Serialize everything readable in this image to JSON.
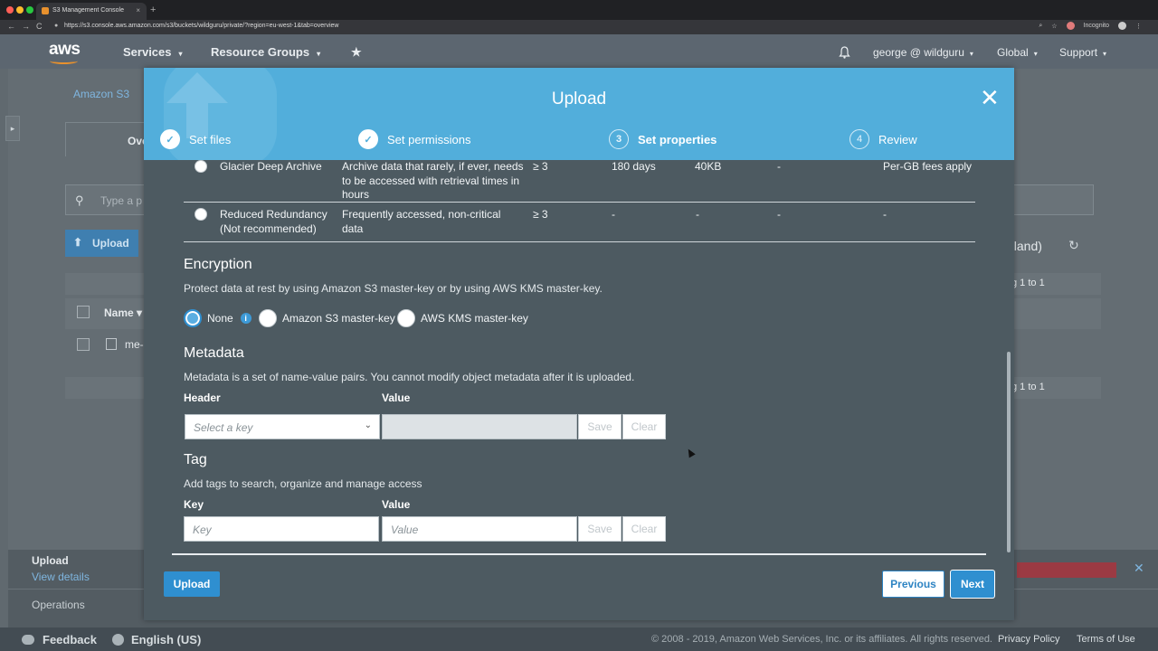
{
  "browser": {
    "tab_title": "S3 Management Console",
    "tab_close": "×",
    "new_tab": "+",
    "url": "https://s3.console.aws.amazon.com/s3/buckets/wildguru/private/?region=eu-west-1&tab=overview",
    "incognito": "Incognito",
    "back": "←",
    "forward": "→",
    "reload": "C"
  },
  "aws_nav": {
    "logo": "aws",
    "services": "Services",
    "resource_groups": "Resource Groups",
    "pin": "★",
    "user": "george @ wildguru",
    "region": "Global",
    "support": "Support",
    "caret": "▾",
    "bell": "🔔"
  },
  "background": {
    "breadcrumb": "Amazon S3",
    "tab_overview": "Ove",
    "search_placeholder": "Type a p",
    "upload_button": "Upload",
    "region_fragment": "eland)",
    "pagination_1": "g 1 to 1",
    "pagination_2": "g 1 to 1",
    "name_header": "Name",
    "file_name": "me-",
    "side_toggle": "▸"
  },
  "ops_bar": {
    "upload_title": "Upload",
    "view_details": "View details",
    "operations": "Operations",
    "close": "✕"
  },
  "footer": {
    "feedback": "Feedback",
    "language": "English (US)",
    "copyright": "© 2008 - 2019, Amazon Web Services, Inc. or its affiliates. All rights reserved.",
    "privacy": "Privacy Policy",
    "terms": "Terms of Use"
  },
  "modal": {
    "title": "Upload",
    "close": "✕",
    "steps": [
      {
        "label": "Set files",
        "marker": "✓"
      },
      {
        "label": "Set permissions",
        "marker": "✓"
      },
      {
        "label": "Set properties",
        "marker": "3"
      },
      {
        "label": "Review",
        "marker": "4"
      }
    ],
    "storage_classes": [
      {
        "name": "Glacier Deep Archive",
        "description": "Archive data that rarely, if ever, needs to be accessed with retrieval times in hours",
        "az": "≥ 3",
        "min_duration": "180 days",
        "min_size": "40KB",
        "monitoring": "-",
        "retrieval": "Per-GB fees apply"
      },
      {
        "name": "Reduced Redundancy (Not recommended)",
        "description": "Frequently accessed, non-critical data",
        "az": "≥ 3",
        "min_duration": "-",
        "min_size": "-",
        "monitoring": "-",
        "retrieval": "-"
      }
    ],
    "encryption": {
      "title": "Encryption",
      "description": "Protect data at rest by using Amazon S3 master-key or by using AWS KMS master-key.",
      "options": [
        "None",
        "Amazon S3 master-key",
        "AWS KMS master-key"
      ],
      "selected": "None",
      "info": "i"
    },
    "metadata": {
      "title": "Metadata",
      "description": "Metadata is a set of name-value pairs. You cannot modify object metadata after it is uploaded.",
      "header_label": "Header",
      "value_label": "Value",
      "select_placeholder": "Select a key",
      "save": "Save",
      "clear": "Clear"
    },
    "tag": {
      "title": "Tag",
      "description": "Add tags to search, organize and manage access",
      "key_label": "Key",
      "value_label": "Value",
      "key_placeholder": "Key",
      "value_placeholder": "Value",
      "save": "Save",
      "clear": "Clear"
    },
    "buttons": {
      "upload": "Upload",
      "previous": "Previous",
      "next": "Next"
    }
  },
  "colors": {
    "modal_header": "#52aedb",
    "primary_button": "#2f8fd0",
    "aws_orange": "#e8912d"
  }
}
